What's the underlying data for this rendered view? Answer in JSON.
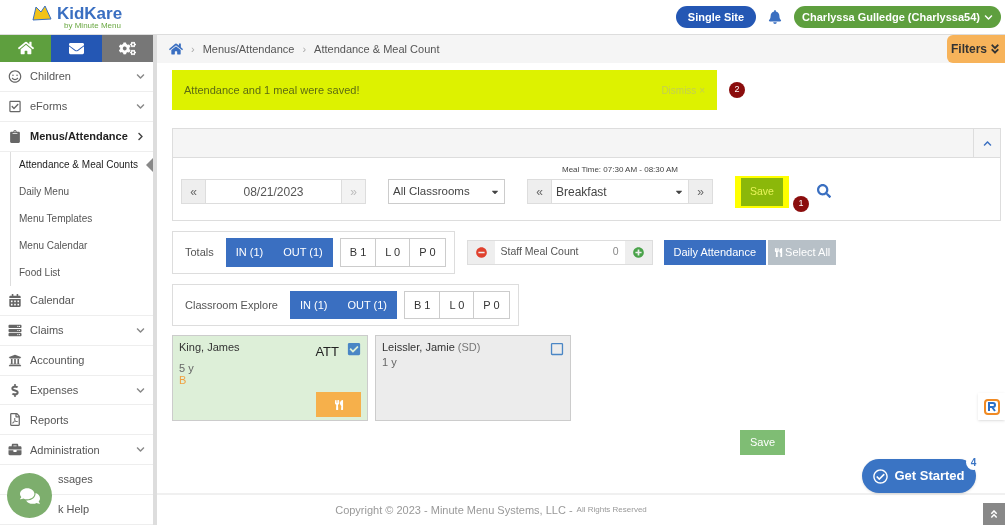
{
  "header": {
    "logo": "KidKare",
    "logo_sub": "by Minute Menu",
    "site_button": "Single Site",
    "user_button": "Charlyssa Gulledge (Charlyssa54)"
  },
  "sidebar": {
    "items": [
      {
        "label": "Children",
        "chevron": true,
        "expanded": false
      },
      {
        "label": "eForms",
        "chevron": true,
        "expanded": false
      },
      {
        "label": "Menus/Attendance",
        "chevron": true,
        "expanded": true,
        "children": [
          {
            "label": "Attendance & Meal Counts",
            "selected": true
          },
          {
            "label": "Daily Menu",
            "selected": false
          },
          {
            "label": "Menu Templates",
            "selected": false
          },
          {
            "label": "Menu Calendar",
            "selected": false
          },
          {
            "label": "Food List",
            "selected": false
          }
        ]
      },
      {
        "label": "Calendar",
        "chevron": false,
        "expanded": false
      },
      {
        "label": "Claims",
        "chevron": true,
        "expanded": false
      },
      {
        "label": "Accounting",
        "chevron": false,
        "expanded": false
      },
      {
        "label": "Expenses",
        "chevron": true,
        "expanded": false
      },
      {
        "label": "Reports",
        "chevron": false,
        "expanded": false
      },
      {
        "label": "Administration",
        "chevron": true,
        "expanded": false
      },
      {
        "label": "ssages",
        "chevron": false,
        "expanded": false
      },
      {
        "label": "k Help",
        "chevron": false,
        "expanded": false
      }
    ]
  },
  "breadcrumb": [
    {
      "kind": "separator",
      "text": "›"
    },
    {
      "kind": "link",
      "text": "Menus/Attendance"
    },
    {
      "kind": "separator",
      "text": "›"
    },
    {
      "kind": "link",
      "text": "Attendance & Meal Count"
    }
  ],
  "filters_button": "Filters",
  "alert": {
    "message": "Attendance and 1 meal were saved!",
    "dismiss": "Dismiss",
    "close": "×",
    "step": "2"
  },
  "controls": {
    "prev": "«",
    "date": "08/21/2023",
    "next": "»",
    "classroom": "All Classrooms",
    "meal_time": "Meal Time: 07:30 AM - 08:30 AM",
    "meal_prev": "«",
    "meal": "Breakfast",
    "meal_next": "»",
    "save": "Save",
    "step": "1"
  },
  "totals": {
    "label": "Totals",
    "in": "IN (1)",
    "out": "OUT (1)",
    "counts": [
      "B 1",
      "L 0",
      "P 0"
    ]
  },
  "staff": {
    "label": "Staff Meal Count",
    "value": "0"
  },
  "daily_attendance": "Daily Attendance",
  "select_all": "Select All",
  "classroom": {
    "label": "Classroom Explore",
    "in": "IN (1)",
    "out": "OUT (1)",
    "counts": [
      "B 1",
      "L 0",
      "P 0"
    ]
  },
  "children": [
    {
      "name": "King, James",
      "age": "5 y",
      "meal": "B",
      "status": "ATT",
      "checked": true
    },
    {
      "name": "Leissler, Jamie",
      "note": "(SD)",
      "age": "1 y",
      "checked": false
    }
  ],
  "bottom_save": "Save",
  "get_started": {
    "label": "Get Started",
    "count": "4"
  },
  "copyright": {
    "main": "Copyright © 2023 - Minute Menu Systems, LLC -",
    "rights": "All Rights Reserved"
  }
}
